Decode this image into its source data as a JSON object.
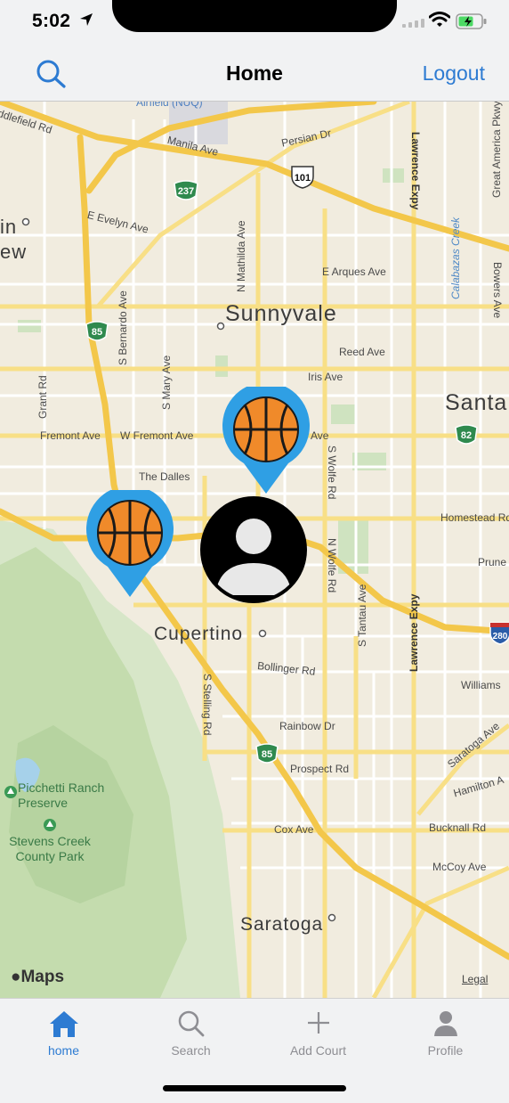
{
  "status_bar": {
    "time": "5:02",
    "icons": [
      "location-arrow-icon",
      "signal-icon",
      "wifi-icon",
      "battery-icon"
    ]
  },
  "nav": {
    "title": "Home",
    "search_icon": "search-icon",
    "logout_label": "Logout",
    "accent": "#2d7bd2"
  },
  "map": {
    "cities": {
      "sunnyvale": "Sunnyvale",
      "cupertino": "Cupertino",
      "saratoga": "Saratoga",
      "santa": "Santa",
      "in": "in",
      "ew": "ew"
    },
    "streets": {
      "airfield": "Airfield (NUQ)",
      "ddlefield": "ddlefield Rd",
      "manila": "Manila Ave",
      "persian": "Persian Dr",
      "evelyn": "E Evelyn Ave",
      "arques": "E Arques Ave",
      "mathilda": "N Mathilda Ave",
      "reed": "Reed Ave",
      "iris": "Iris Ave",
      "bernardo": "S Bernardo Ave",
      "mary": "S Mary Ave",
      "grant": "Grant Rd",
      "fremont": "Fremont Ave",
      "wfremont": "W Fremont Ave",
      "fremont_ave_tail": "Ave",
      "dalles": "The Dalles",
      "wolfe_s": "S Wolfe Rd",
      "wolfe_n": "N Wolfe Rd",
      "homestead": "Homestead Rd",
      "prune": "Prune",
      "lawrence_top": "Lawrence Expy",
      "lawrence_bottom": "Lawrence Expy",
      "calabazas": "Calabazas Creek",
      "great_america": "Great America Pkwy",
      "bowers": "Bowers Ave",
      "tantau": "S Tantau Ave",
      "bollinger": "Bollinger Rd",
      "stelling": "S Stelling Rd",
      "williams": "Williams",
      "rainbow": "Rainbow Dr",
      "prospect": "Prospect Rd",
      "saratoga_ave": "Saratoga Ave",
      "hamilton": "Hamilton A",
      "cox": "Cox Ave",
      "bucknall": "Bucknall Rd",
      "mccoy": "McCoy Ave"
    },
    "parks": {
      "picchetti": "Picchetti Ranch Preserve",
      "stevens": "Stevens Creek County Park"
    },
    "highways": [
      "237",
      "101",
      "85",
      "82",
      "85",
      "280"
    ],
    "brand": "Maps",
    "legal": "Legal",
    "pins": [
      "basketball-court-pin",
      "basketball-court-pin"
    ],
    "user_marker": "user-avatar"
  },
  "tabs": [
    {
      "label": "home",
      "icon": "home-icon",
      "active": true
    },
    {
      "label": "Search",
      "icon": "search-icon",
      "active": false
    },
    {
      "label": "Add Court",
      "icon": "plus-icon",
      "active": false
    },
    {
      "label": "Profile",
      "icon": "person-icon",
      "active": false
    }
  ],
  "colors": {
    "pin_blue": "#2f9fe4",
    "ball_orange": "#f08a2a",
    "road_yellow": "#f3c74a",
    "park_green": "#cfe3c0"
  }
}
